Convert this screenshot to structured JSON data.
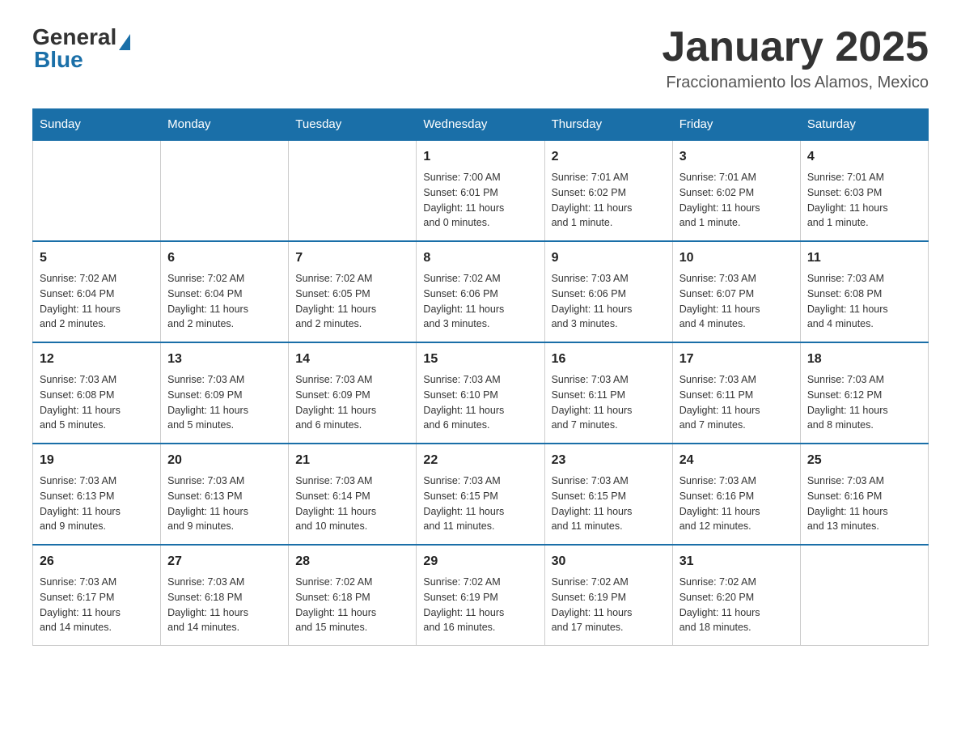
{
  "header": {
    "logo_general": "General",
    "logo_blue": "Blue",
    "month_title": "January 2025",
    "location": "Fraccionamiento los Alamos, Mexico"
  },
  "weekdays": [
    "Sunday",
    "Monday",
    "Tuesday",
    "Wednesday",
    "Thursday",
    "Friday",
    "Saturday"
  ],
  "weeks": [
    [
      {
        "day": "",
        "info": ""
      },
      {
        "day": "",
        "info": ""
      },
      {
        "day": "",
        "info": ""
      },
      {
        "day": "1",
        "info": "Sunrise: 7:00 AM\nSunset: 6:01 PM\nDaylight: 11 hours\nand 0 minutes."
      },
      {
        "day": "2",
        "info": "Sunrise: 7:01 AM\nSunset: 6:02 PM\nDaylight: 11 hours\nand 1 minute."
      },
      {
        "day": "3",
        "info": "Sunrise: 7:01 AM\nSunset: 6:02 PM\nDaylight: 11 hours\nand 1 minute."
      },
      {
        "day": "4",
        "info": "Sunrise: 7:01 AM\nSunset: 6:03 PM\nDaylight: 11 hours\nand 1 minute."
      }
    ],
    [
      {
        "day": "5",
        "info": "Sunrise: 7:02 AM\nSunset: 6:04 PM\nDaylight: 11 hours\nand 2 minutes."
      },
      {
        "day": "6",
        "info": "Sunrise: 7:02 AM\nSunset: 6:04 PM\nDaylight: 11 hours\nand 2 minutes."
      },
      {
        "day": "7",
        "info": "Sunrise: 7:02 AM\nSunset: 6:05 PM\nDaylight: 11 hours\nand 2 minutes."
      },
      {
        "day": "8",
        "info": "Sunrise: 7:02 AM\nSunset: 6:06 PM\nDaylight: 11 hours\nand 3 minutes."
      },
      {
        "day": "9",
        "info": "Sunrise: 7:03 AM\nSunset: 6:06 PM\nDaylight: 11 hours\nand 3 minutes."
      },
      {
        "day": "10",
        "info": "Sunrise: 7:03 AM\nSunset: 6:07 PM\nDaylight: 11 hours\nand 4 minutes."
      },
      {
        "day": "11",
        "info": "Sunrise: 7:03 AM\nSunset: 6:08 PM\nDaylight: 11 hours\nand 4 minutes."
      }
    ],
    [
      {
        "day": "12",
        "info": "Sunrise: 7:03 AM\nSunset: 6:08 PM\nDaylight: 11 hours\nand 5 minutes."
      },
      {
        "day": "13",
        "info": "Sunrise: 7:03 AM\nSunset: 6:09 PM\nDaylight: 11 hours\nand 5 minutes."
      },
      {
        "day": "14",
        "info": "Sunrise: 7:03 AM\nSunset: 6:09 PM\nDaylight: 11 hours\nand 6 minutes."
      },
      {
        "day": "15",
        "info": "Sunrise: 7:03 AM\nSunset: 6:10 PM\nDaylight: 11 hours\nand 6 minutes."
      },
      {
        "day": "16",
        "info": "Sunrise: 7:03 AM\nSunset: 6:11 PM\nDaylight: 11 hours\nand 7 minutes."
      },
      {
        "day": "17",
        "info": "Sunrise: 7:03 AM\nSunset: 6:11 PM\nDaylight: 11 hours\nand 7 minutes."
      },
      {
        "day": "18",
        "info": "Sunrise: 7:03 AM\nSunset: 6:12 PM\nDaylight: 11 hours\nand 8 minutes."
      }
    ],
    [
      {
        "day": "19",
        "info": "Sunrise: 7:03 AM\nSunset: 6:13 PM\nDaylight: 11 hours\nand 9 minutes."
      },
      {
        "day": "20",
        "info": "Sunrise: 7:03 AM\nSunset: 6:13 PM\nDaylight: 11 hours\nand 9 minutes."
      },
      {
        "day": "21",
        "info": "Sunrise: 7:03 AM\nSunset: 6:14 PM\nDaylight: 11 hours\nand 10 minutes."
      },
      {
        "day": "22",
        "info": "Sunrise: 7:03 AM\nSunset: 6:15 PM\nDaylight: 11 hours\nand 11 minutes."
      },
      {
        "day": "23",
        "info": "Sunrise: 7:03 AM\nSunset: 6:15 PM\nDaylight: 11 hours\nand 11 minutes."
      },
      {
        "day": "24",
        "info": "Sunrise: 7:03 AM\nSunset: 6:16 PM\nDaylight: 11 hours\nand 12 minutes."
      },
      {
        "day": "25",
        "info": "Sunrise: 7:03 AM\nSunset: 6:16 PM\nDaylight: 11 hours\nand 13 minutes."
      }
    ],
    [
      {
        "day": "26",
        "info": "Sunrise: 7:03 AM\nSunset: 6:17 PM\nDaylight: 11 hours\nand 14 minutes."
      },
      {
        "day": "27",
        "info": "Sunrise: 7:03 AM\nSunset: 6:18 PM\nDaylight: 11 hours\nand 14 minutes."
      },
      {
        "day": "28",
        "info": "Sunrise: 7:02 AM\nSunset: 6:18 PM\nDaylight: 11 hours\nand 15 minutes."
      },
      {
        "day": "29",
        "info": "Sunrise: 7:02 AM\nSunset: 6:19 PM\nDaylight: 11 hours\nand 16 minutes."
      },
      {
        "day": "30",
        "info": "Sunrise: 7:02 AM\nSunset: 6:19 PM\nDaylight: 11 hours\nand 17 minutes."
      },
      {
        "day": "31",
        "info": "Sunrise: 7:02 AM\nSunset: 6:20 PM\nDaylight: 11 hours\nand 18 minutes."
      },
      {
        "day": "",
        "info": ""
      }
    ]
  ]
}
